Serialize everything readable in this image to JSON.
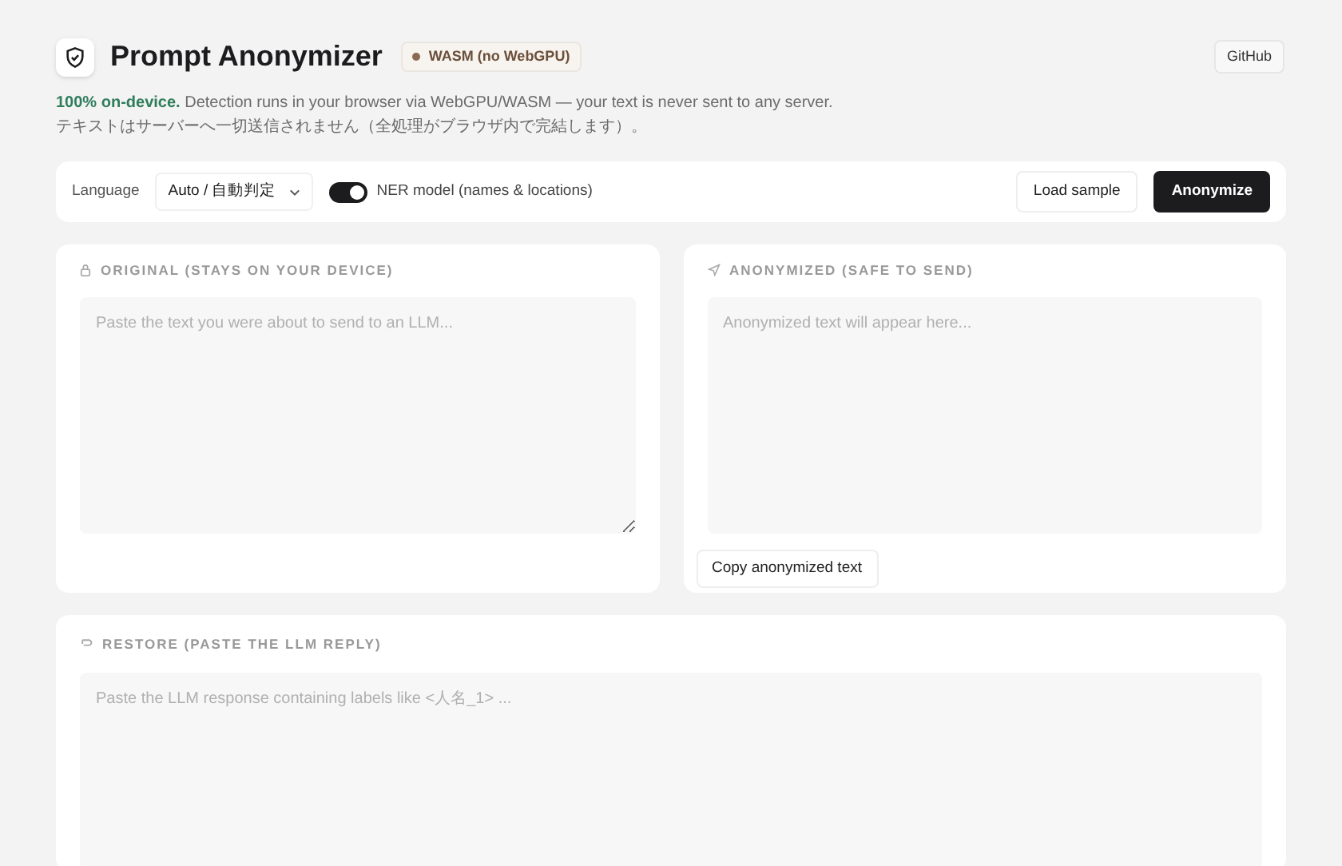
{
  "header": {
    "title": "Prompt Anonymizer",
    "backend_badge": "WASM (no WebGPU)",
    "github_link": "GitHub",
    "description": "**100% on-device.** Detection runs in your browser via WebGPU/WASM — your text is never sent to any server. テキストはサーバーへ一切送信されません（全処理がブラウザ内で完結します）。"
  },
  "toolbar": {
    "language_label": "Language",
    "language_value": "Auto / 自動判定",
    "ner_toggle": {
      "label": "NER model (names & locations)",
      "on": true
    },
    "buttons": [
      {
        "label": "Load sample",
        "kind": "secondary"
      },
      {
        "label": "Anonymize",
        "kind": "primary"
      }
    ]
  },
  "panels": [
    {
      "title": "ORIGINAL (STAYS ON YOUR DEVICE)",
      "placeholder": "Paste the text you were about to send to an LLM...",
      "resizable": true
    },
    {
      "title": "ANONYMIZED (SAFE TO SEND)",
      "placeholder": "Anonymized text will appear here...",
      "resizable": false,
      "action": "Copy anonymized text"
    }
  ],
  "restore": {
    "title": "RESTORE (PASTE THE LLM REPLY)",
    "placeholder": "Paste the LLM response containing labels like <人名_1> ..."
  }
}
